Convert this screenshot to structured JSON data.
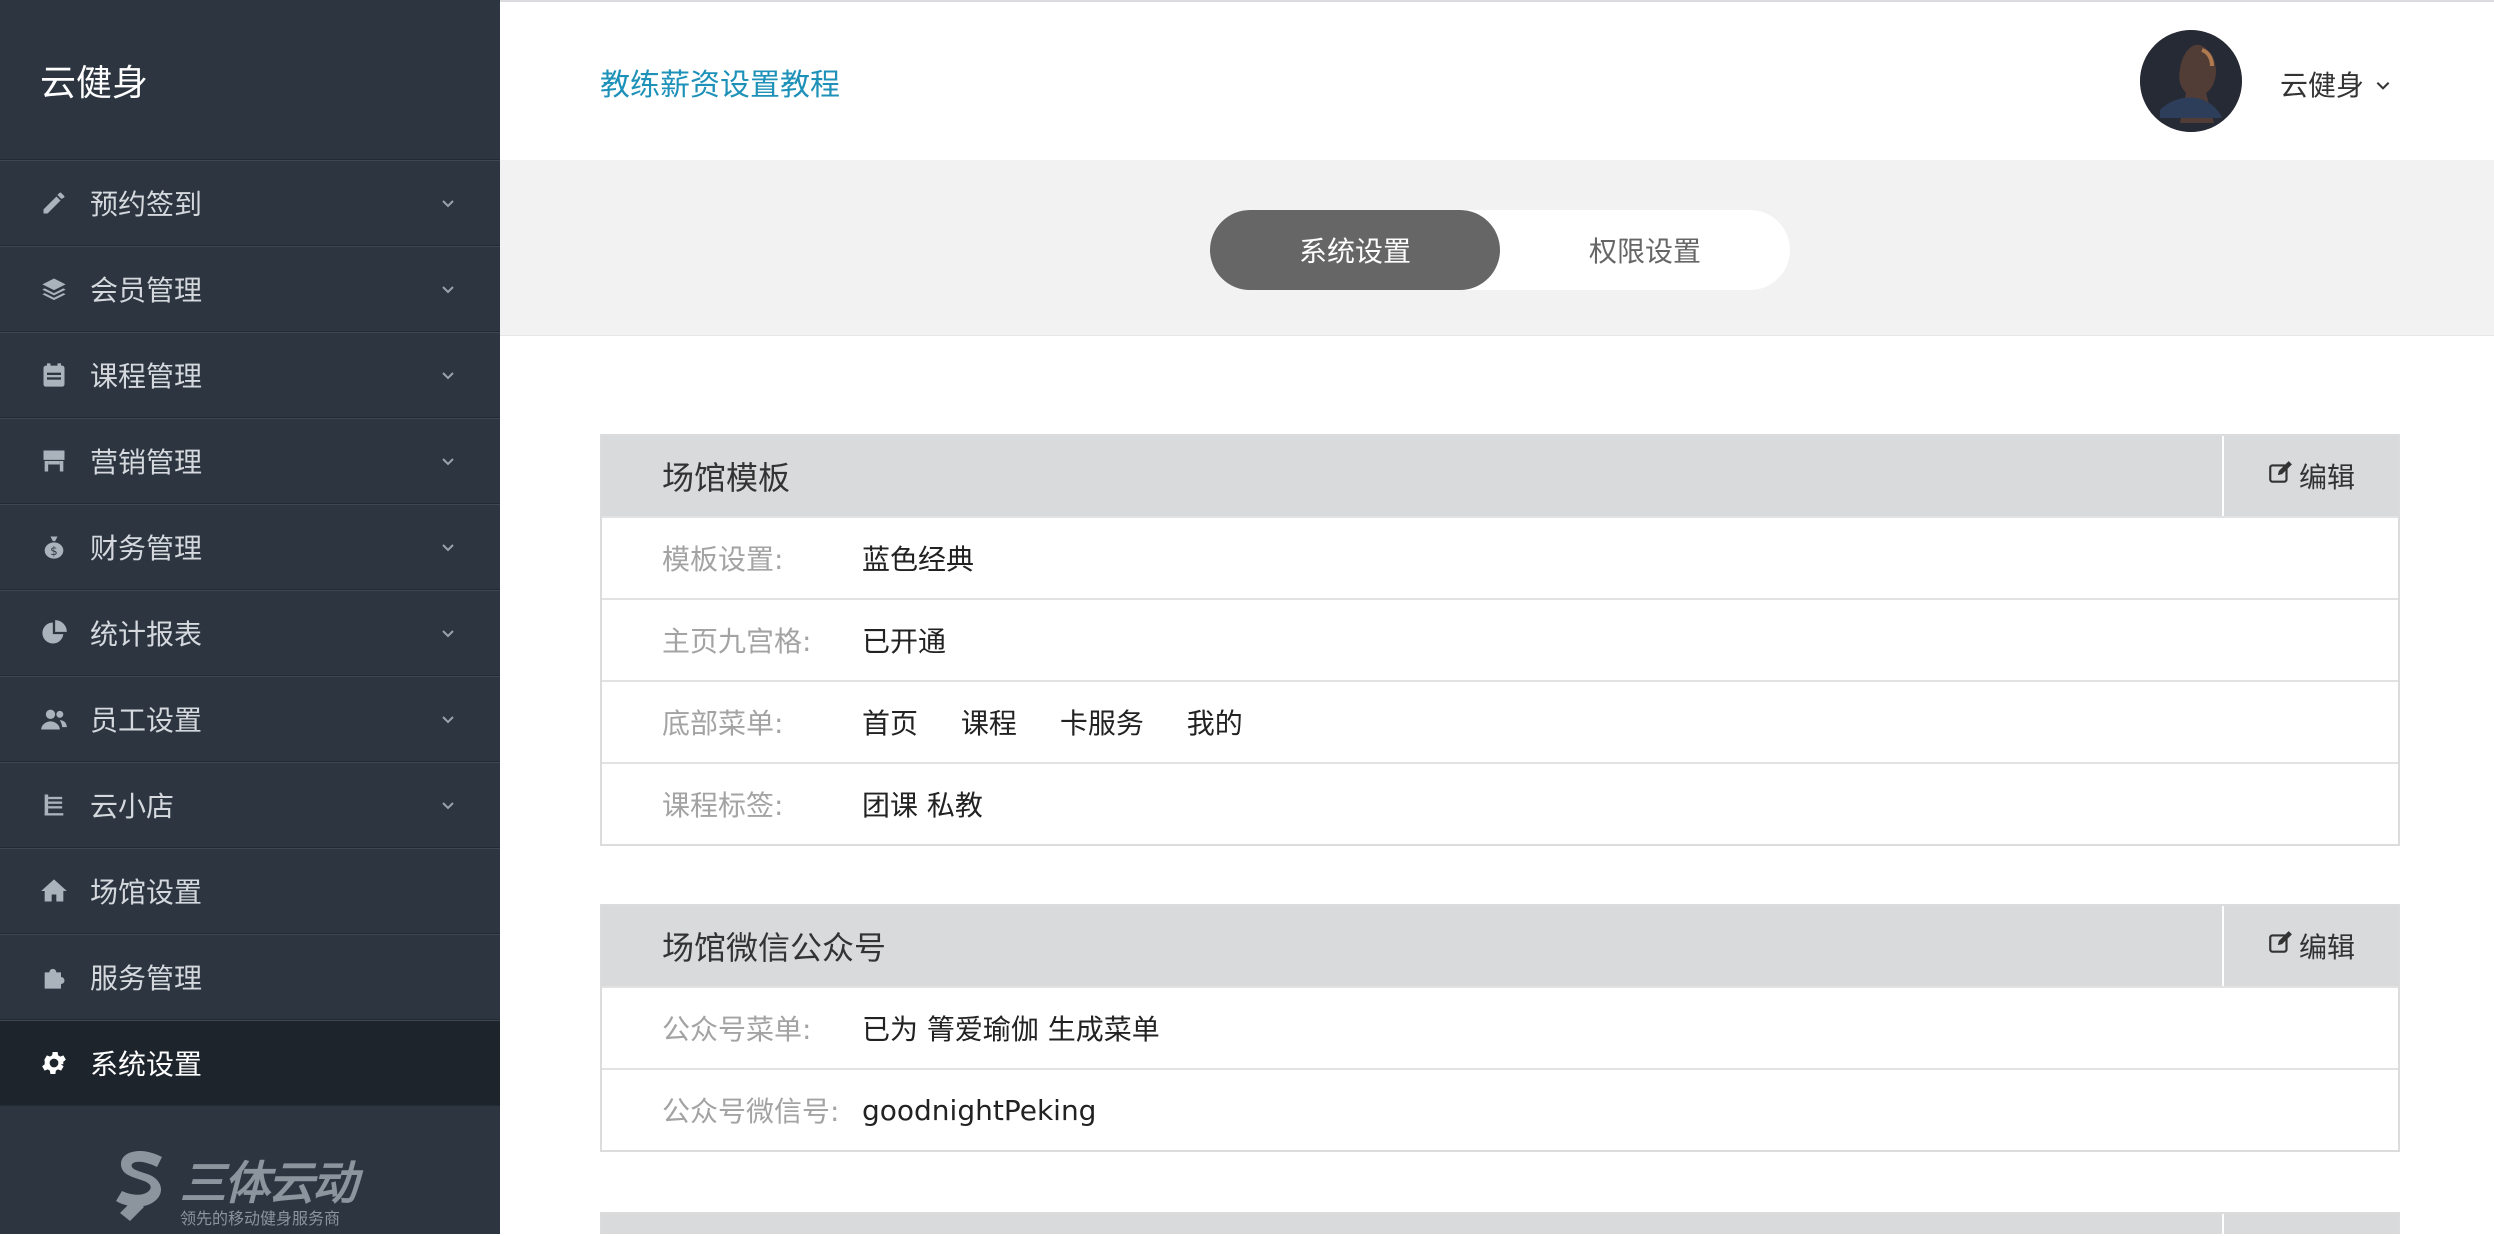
{
  "app": {
    "brand": "云健身"
  },
  "sidebar": {
    "items": [
      {
        "label": "预约签到",
        "icon": "pencil-icon",
        "has_submenu": true
      },
      {
        "label": "会员管理",
        "icon": "layers-icon",
        "has_submenu": true
      },
      {
        "label": "课程管理",
        "icon": "calendar-icon",
        "has_submenu": true
      },
      {
        "label": "营销管理",
        "icon": "storefront-icon",
        "has_submenu": true
      },
      {
        "label": "财务管理",
        "icon": "money-bag-icon",
        "has_submenu": true
      },
      {
        "label": "统计报表",
        "icon": "pie-chart-icon",
        "has_submenu": true
      },
      {
        "label": "员工设置",
        "icon": "users-icon",
        "has_submenu": true
      },
      {
        "label": "云小店",
        "icon": "shop-cart-icon",
        "has_submenu": true
      },
      {
        "label": "场馆设置",
        "icon": "home-icon",
        "has_submenu": false
      },
      {
        "label": "服务管理",
        "icon": "puzzle-icon",
        "has_submenu": false
      },
      {
        "label": "系统设置",
        "icon": "gear-icon",
        "has_submenu": false,
        "active": true
      }
    ],
    "footer_logo": {
      "name": "三体云动",
      "tagline": "领先的移动健身服务商"
    }
  },
  "header": {
    "doc_link": "教练薪资设置教程",
    "user_name": "云健身"
  },
  "tabs": [
    {
      "label": "系统设置",
      "active": true
    },
    {
      "label": "权限设置",
      "active": false
    }
  ],
  "panels": [
    {
      "title": "场馆模板",
      "edit_label": "编辑",
      "rows": [
        {
          "label": "模板设置:",
          "value": "蓝色经典"
        },
        {
          "label": "主页九宫格:",
          "value": "已开通"
        },
        {
          "label": "底部菜单:",
          "items": [
            "首页",
            "课程",
            "卡服务",
            "我的"
          ]
        },
        {
          "label": "课程标签:",
          "value": "团课 私教"
        }
      ]
    },
    {
      "title": "场馆微信公众号",
      "edit_label": "编辑",
      "rows": [
        {
          "label": "公众号菜单:",
          "value": "已为 箐爱瑜伽 生成菜单"
        },
        {
          "label": "公众号微信号:",
          "value": "goodnightPeking"
        }
      ]
    }
  ],
  "colors": {
    "sidebar_bg": "#2c3540",
    "sidebar_active_bg": "#1d242c",
    "link": "#1e91b8",
    "tab_active_bg": "#666666",
    "panel_header_bg": "#d9dadc"
  }
}
